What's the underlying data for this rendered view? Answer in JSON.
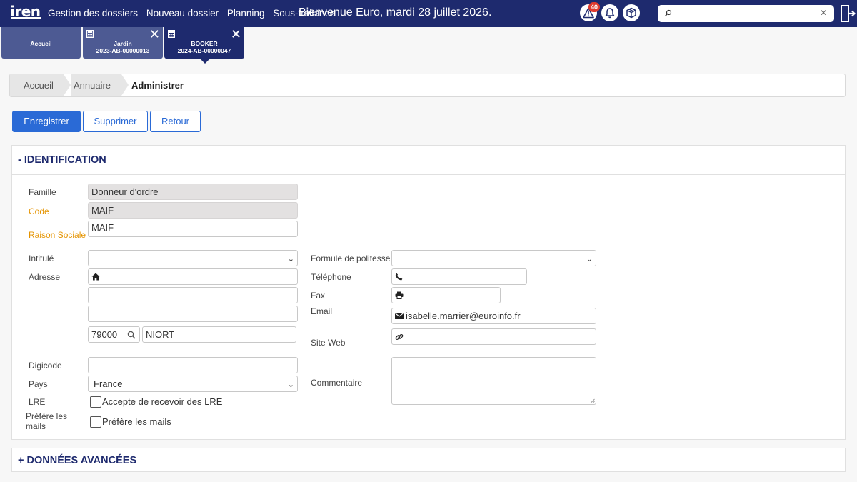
{
  "topbar": {
    "logo": "iren",
    "nav": [
      "Gestion des dossiers",
      "Nouveau dossier",
      "Planning",
      "Sous-traitance"
    ],
    "welcome": "Bienvenue Euro, mardi 28 juillet 2026.",
    "alert_count": "40",
    "search_placeholder": ""
  },
  "tabs": {
    "home": "Accueil",
    "jardin": {
      "title": "Jardin",
      "ref": "2023-AB-00000013"
    },
    "booker": {
      "title": "BOOKER",
      "ref": "2024-AB-00000047"
    }
  },
  "breadcrumb": [
    "Accueil",
    "Annuaire",
    "Administrer"
  ],
  "actions": {
    "save": "Enregistrer",
    "delete": "Supprimer",
    "back": "Retour"
  },
  "identification": {
    "title": "- IDENTIFICATION",
    "labels": {
      "famille": "Famille",
      "code": "Code",
      "raison": "Raison Sociale",
      "intitule": "Intitulé",
      "adresse": "Adresse",
      "digicode": "Digicode",
      "pays": "Pays",
      "lre": "LRE",
      "prefere": "Préfère les mails",
      "formule": "Formule de politesse",
      "telephone": "Téléphone",
      "fax": "Fax",
      "email": "Email",
      "site": "Site Web",
      "commentaire": "Commentaire"
    },
    "values": {
      "famille": "Donneur d'ordre",
      "code": "MAIF",
      "raison": "MAIF",
      "intitule": "",
      "adresse1": "",
      "adresse2": "",
      "adresse3": "",
      "cp": "79000",
      "ville": "NIORT",
      "digicode": "",
      "pays": "France",
      "formule": "",
      "telephone": "",
      "fax": "",
      "email": "isabelle.marrier@euroinfo.fr",
      "site": "",
      "commentaire": ""
    },
    "checkboxes": {
      "lre": "Accepte de recevoir des LRE",
      "mails": "Préfère les mails"
    }
  },
  "advanced": {
    "title": "+ DONNÉES AVANCÉES"
  },
  "colors": {
    "navy": "#1e2a6e",
    "accent": "#2a6ad6",
    "required": "#e59400",
    "badge": "#e03a2e"
  }
}
